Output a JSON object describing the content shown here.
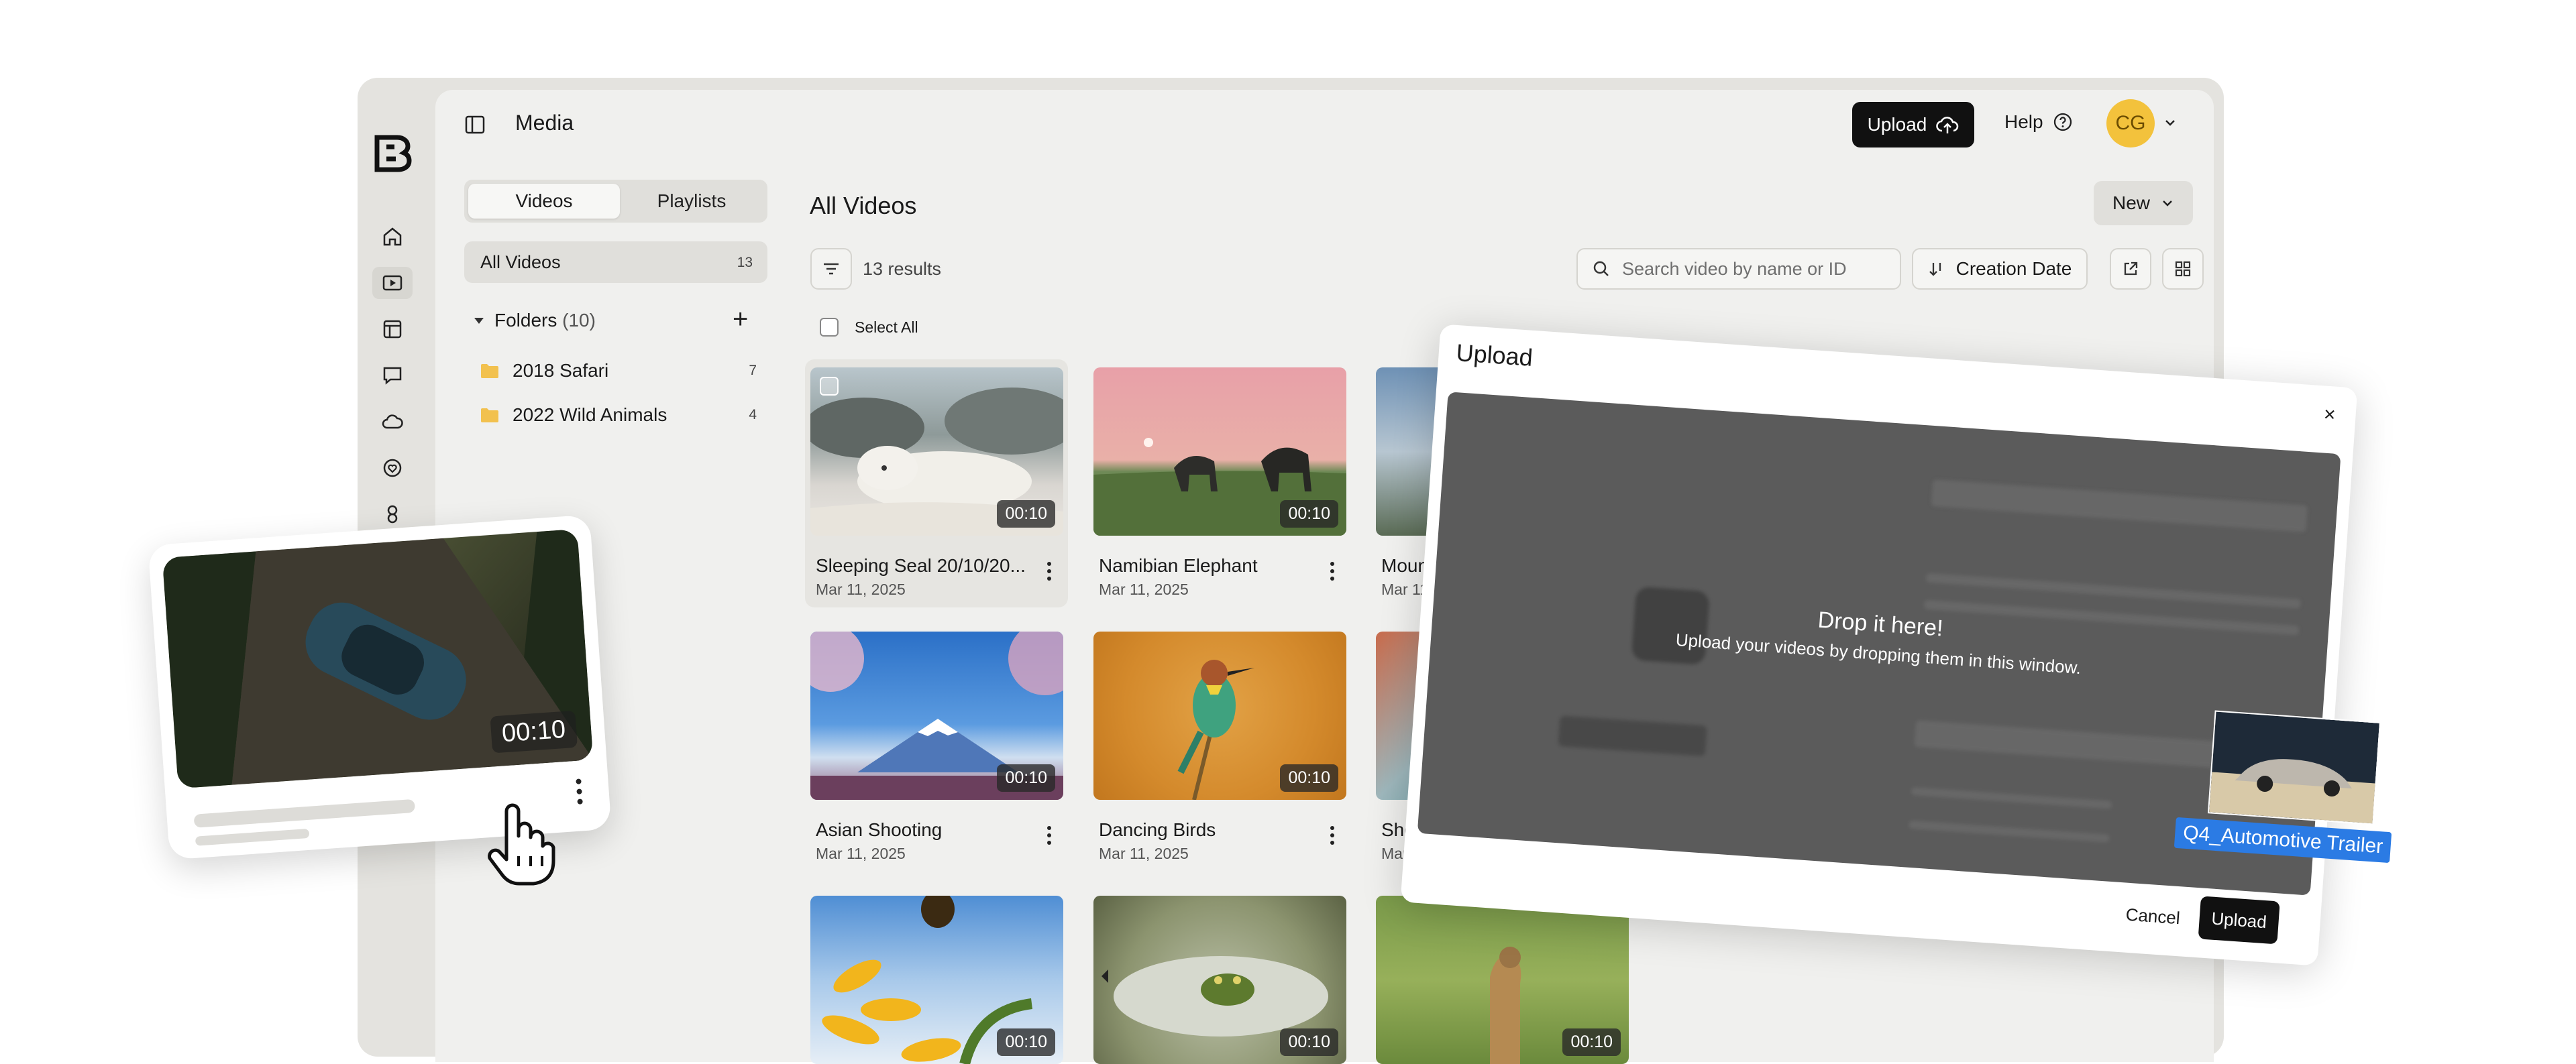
{
  "header": {
    "title": "Media",
    "upload_label": "Upload",
    "help_label": "Help",
    "avatar_initials": "CG"
  },
  "sidebar": {
    "tabs": [
      "Videos",
      "Playlists"
    ],
    "all_videos": {
      "label": "All Videos",
      "count": "13"
    },
    "folders_label": "Folders",
    "folders_count": "(10)",
    "folders": [
      {
        "name": "2018 Safari",
        "count": "7"
      },
      {
        "name": "2022 Wild Animals",
        "count": "4"
      }
    ]
  },
  "content": {
    "title": "All Videos",
    "new_label": "New",
    "results": "13 results",
    "search_placeholder": "Search video by name or ID",
    "sort_label": "Creation Date",
    "select_all": "Select All"
  },
  "videos": [
    {
      "name": "Sleeping Seal 20/10/20...",
      "date": "Mar 11, 2025",
      "duration": "00:10"
    },
    {
      "name": "Namibian Elephant",
      "date": "Mar 11, 2025",
      "duration": "00:10"
    },
    {
      "name": "Moun",
      "date": "Mar 11,",
      "duration": ""
    },
    {
      "name": "Asian Shooting",
      "date": "Mar 11, 2025",
      "duration": "00:10"
    },
    {
      "name": "Dancing Birds",
      "date": "Mar 11, 2025",
      "duration": "00:10"
    },
    {
      "name": "Sho",
      "date": "Mar",
      "duration": ""
    },
    {
      "name": "",
      "date": "",
      "duration": "00:10"
    },
    {
      "name": "",
      "date": "",
      "duration": "00:10"
    },
    {
      "name": "",
      "date": "",
      "duration": "00:10"
    }
  ],
  "upload_modal": {
    "title": "Upload",
    "close": "×",
    "drop_title": "Drop it here!",
    "drop_sub": "Upload your videos by dropping them in this window.",
    "cancel": "Cancel",
    "upload": "Upload"
  },
  "dragged_file": {
    "name": "Q4_Automotive Trailer"
  },
  "floating_card": {
    "duration": "00:10"
  },
  "colors": {
    "accent": "#111111",
    "avatar": "#f3c23c",
    "folder": "#f2c14e",
    "drag_label": "#2b7be4"
  }
}
